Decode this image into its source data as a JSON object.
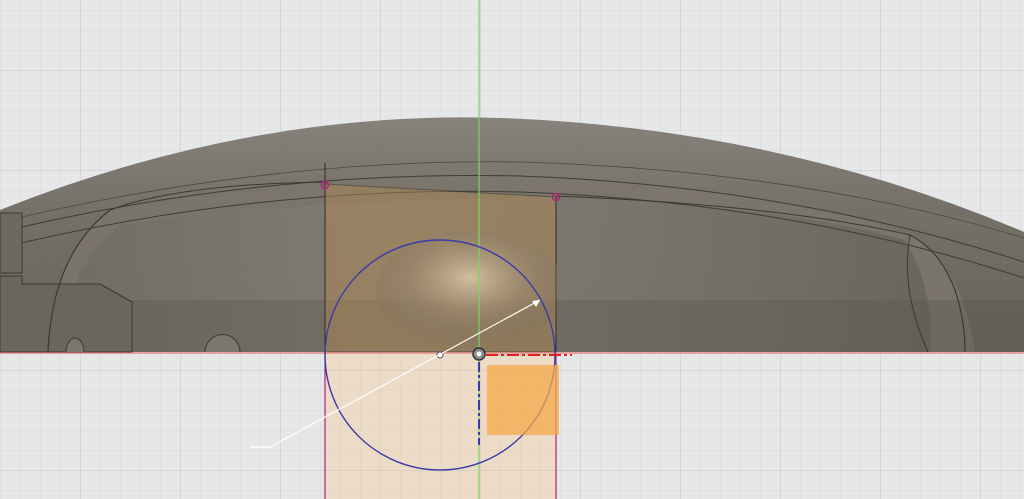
{
  "app": {
    "type": "cad-sketch-viewport"
  },
  "viewport": {
    "background_color": "#e6e7e9",
    "grid_minor_color": "#d7d9dc",
    "grid_major_color": "#c9ccd0",
    "axis_y_color": "#7bd36b",
    "axis_x_color": "#e07a7a",
    "body_color": "#6e6a62",
    "body_highlight_color": "#8a857a",
    "projection_fill_color": "#f3c58a",
    "sketch_circle_color": "#3a3aa8",
    "constraint_color": "#b0207a",
    "selection_color": "#f6a94a",
    "dimension_color": "#e02020",
    "origin_label": "",
    "grid_visible": true
  }
}
